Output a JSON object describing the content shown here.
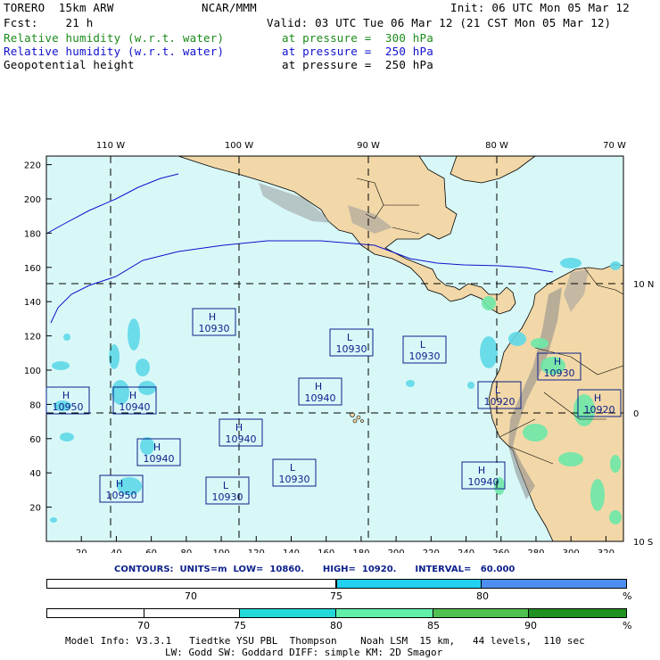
{
  "header": {
    "model": "TORERO  15km ARW",
    "org": "NCAR/MMM",
    "init": "Init: 06 UTC Mon 05 Mar 12",
    "fcst": "Fcst:    21 h",
    "valid": "Valid: 03 UTC Tue 06 Mar 12 (21 CST Mon 05 Mar 12)",
    "fields": [
      {
        "name": "Relative humidity (w.r.t. water)",
        "level": "at pressure =  300 hPa",
        "color": "#1a8a1a"
      },
      {
        "name": "Relative humidity (w.r.t. water)",
        "level": "at pressure =  250 hPa",
        "color": "#1010cc"
      },
      {
        "name": "Geopotential height",
        "level": "at pressure =  250 hPa",
        "color": "#000000"
      }
    ]
  },
  "map": {
    "top_lon_labels": [
      "110 W",
      "100 W",
      "90 W",
      "80 W",
      "70 W"
    ],
    "right_lat_labels": [
      "10 N",
      "0",
      "10 S"
    ],
    "x_ticks": [
      "20",
      "40",
      "60",
      "80",
      "100",
      "120",
      "140",
      "160",
      "180",
      "200",
      "220",
      "240",
      "260",
      "280",
      "300",
      "320"
    ],
    "y_ticks": [
      "220",
      "200",
      "180",
      "160",
      "140",
      "120",
      "100",
      "80",
      "60",
      "40",
      "20"
    ],
    "ocean_color": "#d8f8f8",
    "land_color": "#f2d8a8",
    "centers": [
      {
        "type": "H",
        "value": "10930"
      },
      {
        "type": "L",
        "value": "10930"
      },
      {
        "type": "L",
        "value": "10930"
      },
      {
        "type": "H",
        "value": "10950"
      },
      {
        "type": "H",
        "value": "10940"
      },
      {
        "type": "H",
        "value": "10940"
      },
      {
        "type": "H",
        "value": "10930"
      },
      {
        "type": "L",
        "value": "10920"
      },
      {
        "type": "H",
        "value": "10920"
      },
      {
        "type": "H",
        "value": "10940"
      },
      {
        "type": "H",
        "value": "10940"
      },
      {
        "type": "L",
        "value": "10930"
      },
      {
        "type": "H",
        "value": "10950"
      },
      {
        "type": "L",
        "value": "10930"
      },
      {
        "type": "H",
        "value": "10940"
      }
    ]
  },
  "contours_line": "CONTOURS:  UNITS=m  LOW=  10860.      HIGH=  10920.      INTERVAL=   60.000",
  "bar1": {
    "labels": [
      "70",
      "75",
      "80",
      "%"
    ],
    "colors": [
      "#ffffff",
      "#ffffff",
      "#22d0f0",
      "#4d8ff0"
    ]
  },
  "bar2": {
    "labels": [
      "70",
      "75",
      "80",
      "85",
      "90",
      "%"
    ],
    "colors": [
      "#ffffff",
      "#ffffff",
      "#22d8d8",
      "#60f0a8",
      "#50c050",
      "#209020"
    ]
  },
  "footer": {
    "line1": "Model Info: V3.3.1   Tiedtke YSU PBL  Thompson    Noah LSM  15 km,   44 levels,  110 sec",
    "line2": "LW: Godd SW: Goddard DIFF: simple KM: 2D Smagor"
  }
}
